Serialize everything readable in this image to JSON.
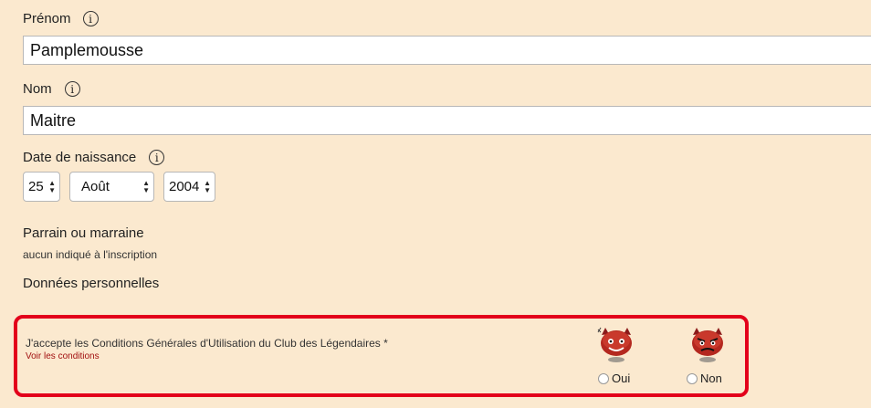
{
  "first_name": {
    "label": "Prénom",
    "value": "Pamplemousse",
    "info_icon": "info-icon"
  },
  "last_name": {
    "label": "Nom",
    "value": "Maitre",
    "info_icon": "info-icon"
  },
  "birth_date": {
    "label": "Date de naissance",
    "info_icon": "info-icon",
    "day": "25",
    "month": "Août",
    "year": "2004"
  },
  "sponsor": {
    "title": "Parrain ou marraine",
    "value": "aucun indiqué à l'inscription"
  },
  "personal_data": {
    "title": "Données personnelles"
  },
  "terms": {
    "text": "J'accepte les Conditions Générales d'Utilisation du Club des Légendaires *",
    "link": "Voir les conditions",
    "options": [
      {
        "label": "Oui",
        "icon": "happy-devil-mascot-icon"
      },
      {
        "label": "Non",
        "icon": "angry-devil-mascot-icon"
      }
    ],
    "highlight_color": "#e3001b"
  },
  "colors": {
    "background": "#fbe9cf",
    "link": "#a21010"
  }
}
